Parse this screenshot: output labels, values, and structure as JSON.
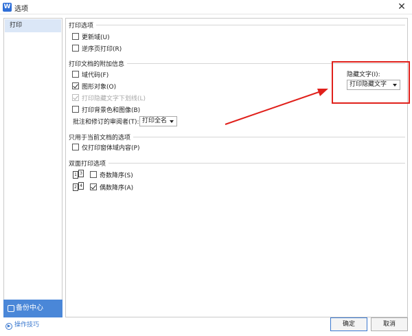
{
  "window": {
    "title": "选项",
    "app_icon_letter": "W",
    "close_glyph": "✕"
  },
  "sidebar": {
    "items": [
      {
        "label": "打印"
      }
    ],
    "backup_label": "备份中心",
    "tips_label": "操作技巧"
  },
  "groups": {
    "print_options": {
      "title": "打印选项",
      "items": [
        {
          "label": "更新域(U)",
          "checked": false
        },
        {
          "label": "逆序页打印(R)",
          "checked": false
        }
      ]
    },
    "extra_info": {
      "title": "打印文档的附加信息",
      "items": [
        {
          "label": "域代码(F)",
          "checked": false
        },
        {
          "label": "图形对象(O)",
          "checked": true
        },
        {
          "label": "打印隐藏文字下划线(L)",
          "checked": true,
          "disabled": true
        },
        {
          "label": "打印背景色和图像(B)",
          "checked": false
        }
      ],
      "reviewer_label": "批注和修订的审阅者(T):",
      "reviewer_value": "打印全名"
    },
    "current_doc": {
      "title": "只用于当前文档的选项",
      "items": [
        {
          "label": "仅打印窗体域内容(P)",
          "checked": false
        }
      ]
    },
    "duplex": {
      "title": "双面打印选项",
      "items": [
        {
          "label": "奇数降序(S)",
          "checked": false,
          "icon_pages": [
            "1",
            "3"
          ]
        },
        {
          "label": "偶数降序(A)",
          "checked": true,
          "icon_pages": [
            "2",
            "4"
          ]
        }
      ]
    }
  },
  "hidden_text": {
    "label": "隐藏文字(I):",
    "value": "打印隐藏文字"
  },
  "footer": {
    "ok_label": "确定",
    "cancel_label": "取消"
  },
  "colors": {
    "accent": "#4a87d8",
    "highlight": "#e0201b",
    "sidebar_selected": "#dbe7f7"
  }
}
